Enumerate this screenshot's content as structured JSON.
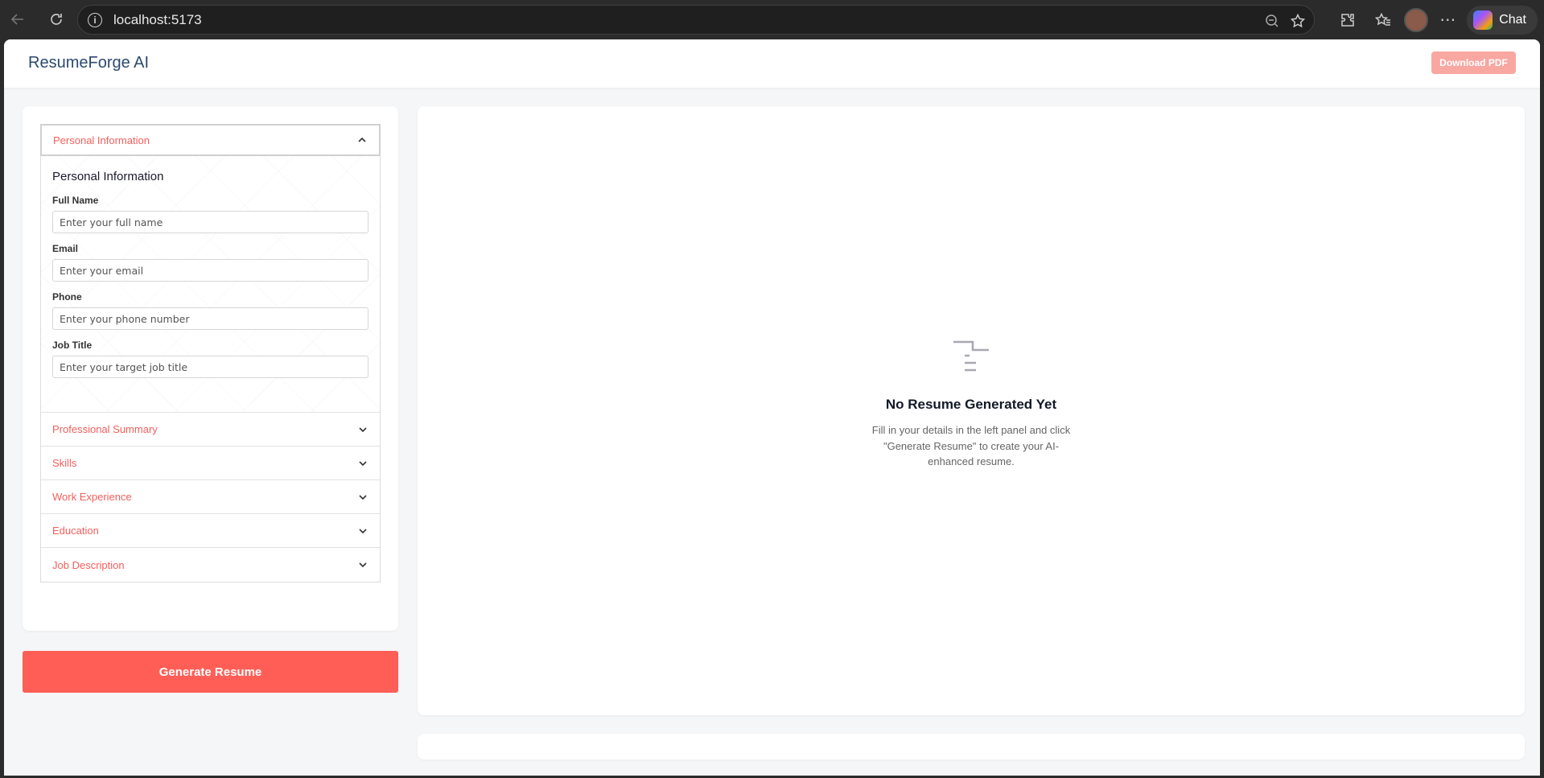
{
  "browser": {
    "url": "localhost:5173",
    "chat_label": "Chat"
  },
  "header": {
    "brand": "ResumeForge AI",
    "download_label": "Download PDF"
  },
  "form": {
    "open_section": {
      "label": "Personal Information",
      "heading": "Personal Information",
      "fields": [
        {
          "label": "Full Name",
          "placeholder": "Enter your full name"
        },
        {
          "label": "Email",
          "placeholder": "Enter your email"
        },
        {
          "label": "Phone",
          "placeholder": "Enter your phone number"
        },
        {
          "label": "Job Title",
          "placeholder": "Enter your target job title"
        }
      ]
    },
    "collapsed_sections": [
      {
        "label": "Professional Summary"
      },
      {
        "label": "Skills"
      },
      {
        "label": "Work Experience"
      },
      {
        "label": "Education"
      },
      {
        "label": "Job Description"
      }
    ],
    "generate_label": "Generate Resume"
  },
  "preview": {
    "empty_title": "No Resume Generated Yet",
    "empty_description": "Fill in your details in the left panel and click \"Generate Resume\" to create your AI-enhanced resume.",
    "icon": "document-lines-icon"
  },
  "colors": {
    "accent": "#f25f5c",
    "generate_button": "#ff5e57",
    "download_button": "#f9a7a1",
    "brand": "#2b4a6f"
  }
}
